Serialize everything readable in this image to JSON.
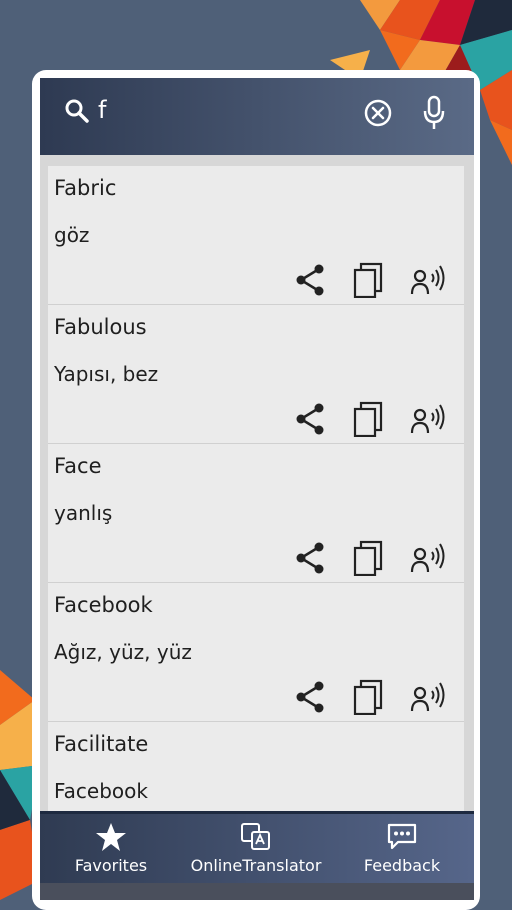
{
  "search": {
    "query": "f"
  },
  "entries": [
    {
      "word": "Fabric",
      "translation": "göz"
    },
    {
      "word": "Fabulous",
      "translation": "Yapısı, bez"
    },
    {
      "word": "Face",
      "translation": "yanlış"
    },
    {
      "word": "Facebook",
      "translation": "Ağız, yüz, yüz"
    },
    {
      "word": "Facilitate",
      "translation": "Facebook"
    }
  ],
  "nav": {
    "favorites": "Favorites",
    "online_translator": "OnlineTranslator",
    "feedback": "Feedback"
  },
  "colors": {
    "background": "#4f6078",
    "topbar": "#2e3a52",
    "accent_orange": "#f26b1d",
    "accent_teal": "#2aa3a3",
    "accent_red": "#c8102e"
  }
}
